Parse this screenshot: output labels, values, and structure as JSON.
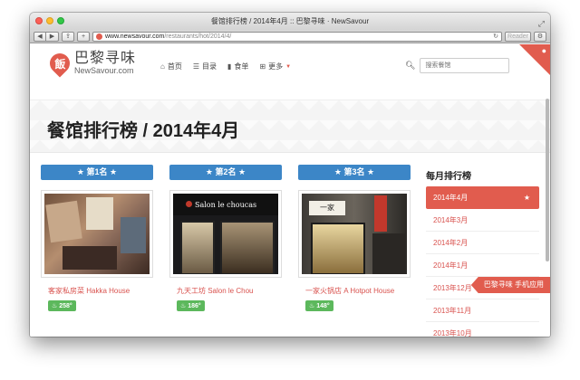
{
  "window": {
    "title": "餐馆排行榜 / 2014年4月 :: 巴黎寻味 · NewSavour"
  },
  "toolbar": {
    "back_label": "◀",
    "forward_label": "▶",
    "share_label": "⇪",
    "add_label": "+",
    "url_domain": "www.newsavour.com",
    "url_path": "/restaurants/hot/2014/4/",
    "reload_label": "↻",
    "reader_label": "Reader"
  },
  "site": {
    "logo_char": "飯",
    "logo_cn": "巴黎寻味",
    "logo_en": "NewSavour.com",
    "nav": [
      {
        "label": "首页",
        "icon": "home-icon"
      },
      {
        "label": "目录",
        "icon": "list-icon"
      },
      {
        "label": "食单",
        "icon": "bookmark-icon"
      },
      {
        "label": "更多",
        "icon": "grid-icon"
      }
    ],
    "search_placeholder": "搜索餐馆"
  },
  "page": {
    "title": "餐馆排行榜 / 2014年4月"
  },
  "cards": [
    {
      "rank": "★ 第1名 ★",
      "name": "客家私房菜 Hakka House",
      "score": "258°"
    },
    {
      "rank": "★ 第2名 ★",
      "name": "九天工坊 Salon le Chou",
      "score": "186°",
      "sign": "Salon le choucas"
    },
    {
      "rank": "★ 第3名 ★",
      "name": "一家火锅店 A Hotpot House",
      "score": "148°",
      "sign": "一家"
    }
  ],
  "sidebar": {
    "title": "每月排行榜",
    "months": [
      "2014年4月",
      "2014年3月",
      "2014年2月",
      "2014年1月",
      "2013年12月",
      "2013年11月",
      "2013年10月"
    ]
  },
  "app_banner": "巴黎寻味 手机应用",
  "colors": {
    "accent": "#e15c4e",
    "rank_blue": "#3c86c7",
    "score_green": "#5cb85c"
  }
}
